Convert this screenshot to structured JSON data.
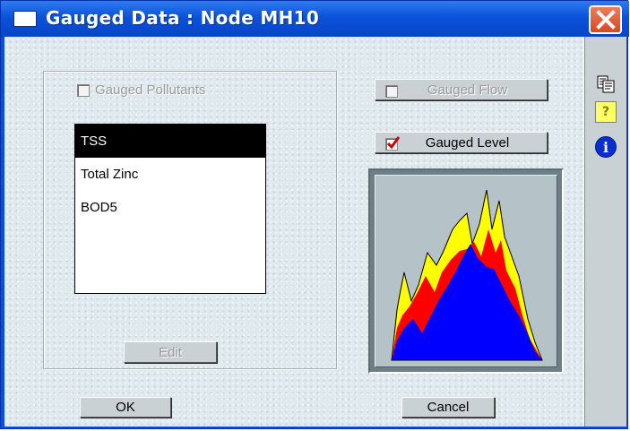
{
  "window": {
    "title": "Gauged Data : Node MH10"
  },
  "pollutants": {
    "checkbox_label": "Gauged Pollutants",
    "items": [
      "TSS",
      "Total Zinc",
      "BOD5"
    ],
    "selected_index": 0,
    "edit_label": "Edit"
  },
  "gauged_flow": {
    "label": "Gauged Flow",
    "checked": false
  },
  "gauged_level": {
    "label": "Gauged Level",
    "checked": true
  },
  "buttons": {
    "ok": "OK",
    "cancel": "Cancel"
  },
  "toolbar": {
    "copy_icon": "copy-icon",
    "help_glyph": "?",
    "info_glyph": "i"
  },
  "colors": {
    "title_bar": "#0a52d9",
    "close_button": "#d9471f",
    "chart_yellow": "#ffff00",
    "chart_red": "#ff0000",
    "chart_blue": "#0000ff",
    "check_mark": "#cc0000"
  }
}
